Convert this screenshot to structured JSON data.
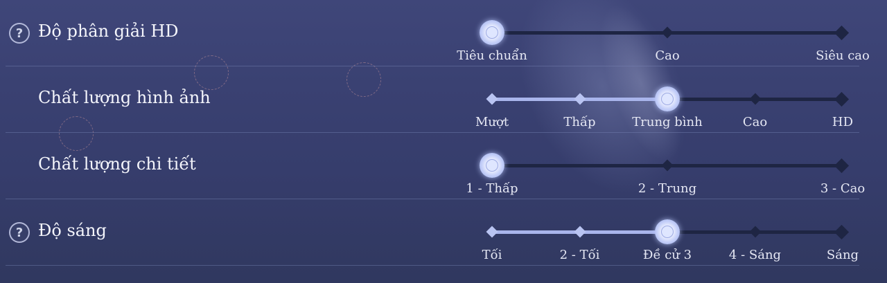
{
  "settings": [
    {
      "id": "hd-resolution",
      "label": "Độ phân giải HD",
      "has_help": true,
      "help_icon": "question-circle-icon",
      "options": [
        "Tiêu chuẩn",
        "Cao",
        "Siêu cao"
      ],
      "selected_index": 0
    },
    {
      "id": "image-quality",
      "label": "Chất lượng hình ảnh",
      "has_help": false,
      "options": [
        "Mượt",
        "Thấp",
        "Trung bình",
        "Cao",
        "HD"
      ],
      "selected_index": 2
    },
    {
      "id": "detail-quality",
      "label": "Chất lượng chi tiết",
      "has_help": false,
      "options": [
        "1 - Thấp",
        "2 - Trung",
        "3 - Cao"
      ],
      "selected_index": 0
    },
    {
      "id": "brightness",
      "label": "Độ sáng",
      "has_help": true,
      "help_icon": "question-circle-icon",
      "options": [
        "Tối",
        "2 - Tối",
        "Đề cử 3",
        "4 - Sáng",
        "Sáng"
      ],
      "selected_index": 2
    }
  ],
  "help_glyph": "?",
  "colors": {
    "background": "#3a4172",
    "track": "#1e2543",
    "track_filled": "#a9b5ec",
    "knob": "#dfe6ff",
    "text": "#f4f5fb"
  }
}
